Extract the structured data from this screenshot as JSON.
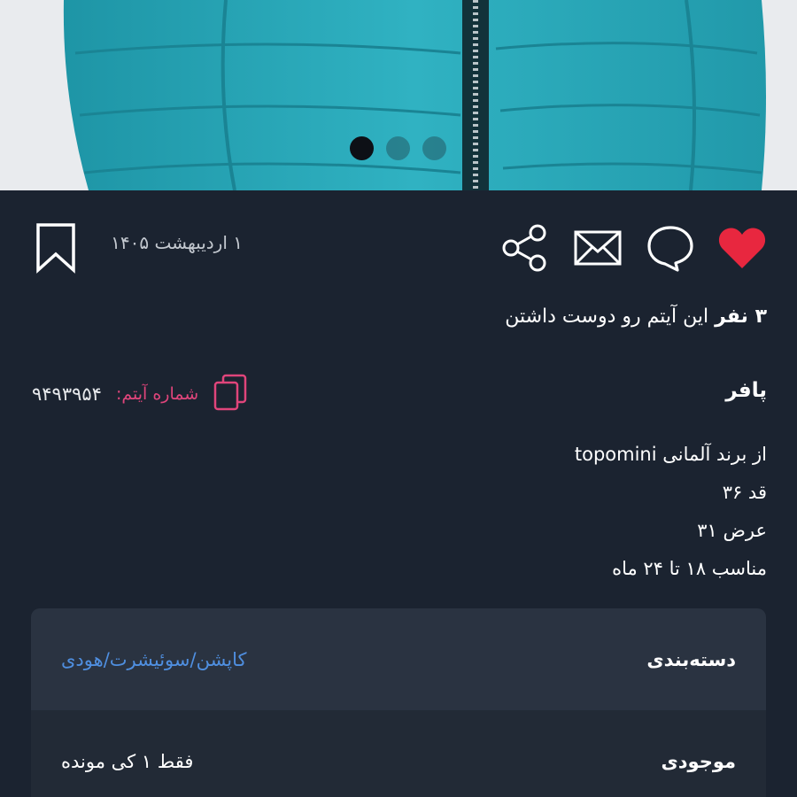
{
  "gallery": {
    "dots": [
      true,
      false,
      false
    ]
  },
  "meta": {
    "date": "۱ اردیبهشت ۱۴۰۵"
  },
  "likes": {
    "count": "۳ نفر",
    "text": " این آیتم رو دوست داشتن"
  },
  "item": {
    "title": "پافر",
    "number_label": "شماره آیتم:",
    "number": "۹۴۹۳۹۵۴",
    "description": [
      "از برند آلمانی topomini",
      "قد ۳۶",
      "عرض ۳۱",
      "مناسب ۱۸ تا ۲۴ ماه"
    ]
  },
  "info": {
    "category_label": "دسته‌بندی",
    "category_value": "کاپشن/سوئیشرت/هودی",
    "stock_label": "موجودی",
    "stock_value": "فقط ۱ کی مونده"
  },
  "colors": {
    "background": "#1b2330",
    "heart": "#e8273f",
    "accent_pink": "#e0457b",
    "link_blue": "#4f8fe0",
    "jacket": "#2aa7b8"
  }
}
